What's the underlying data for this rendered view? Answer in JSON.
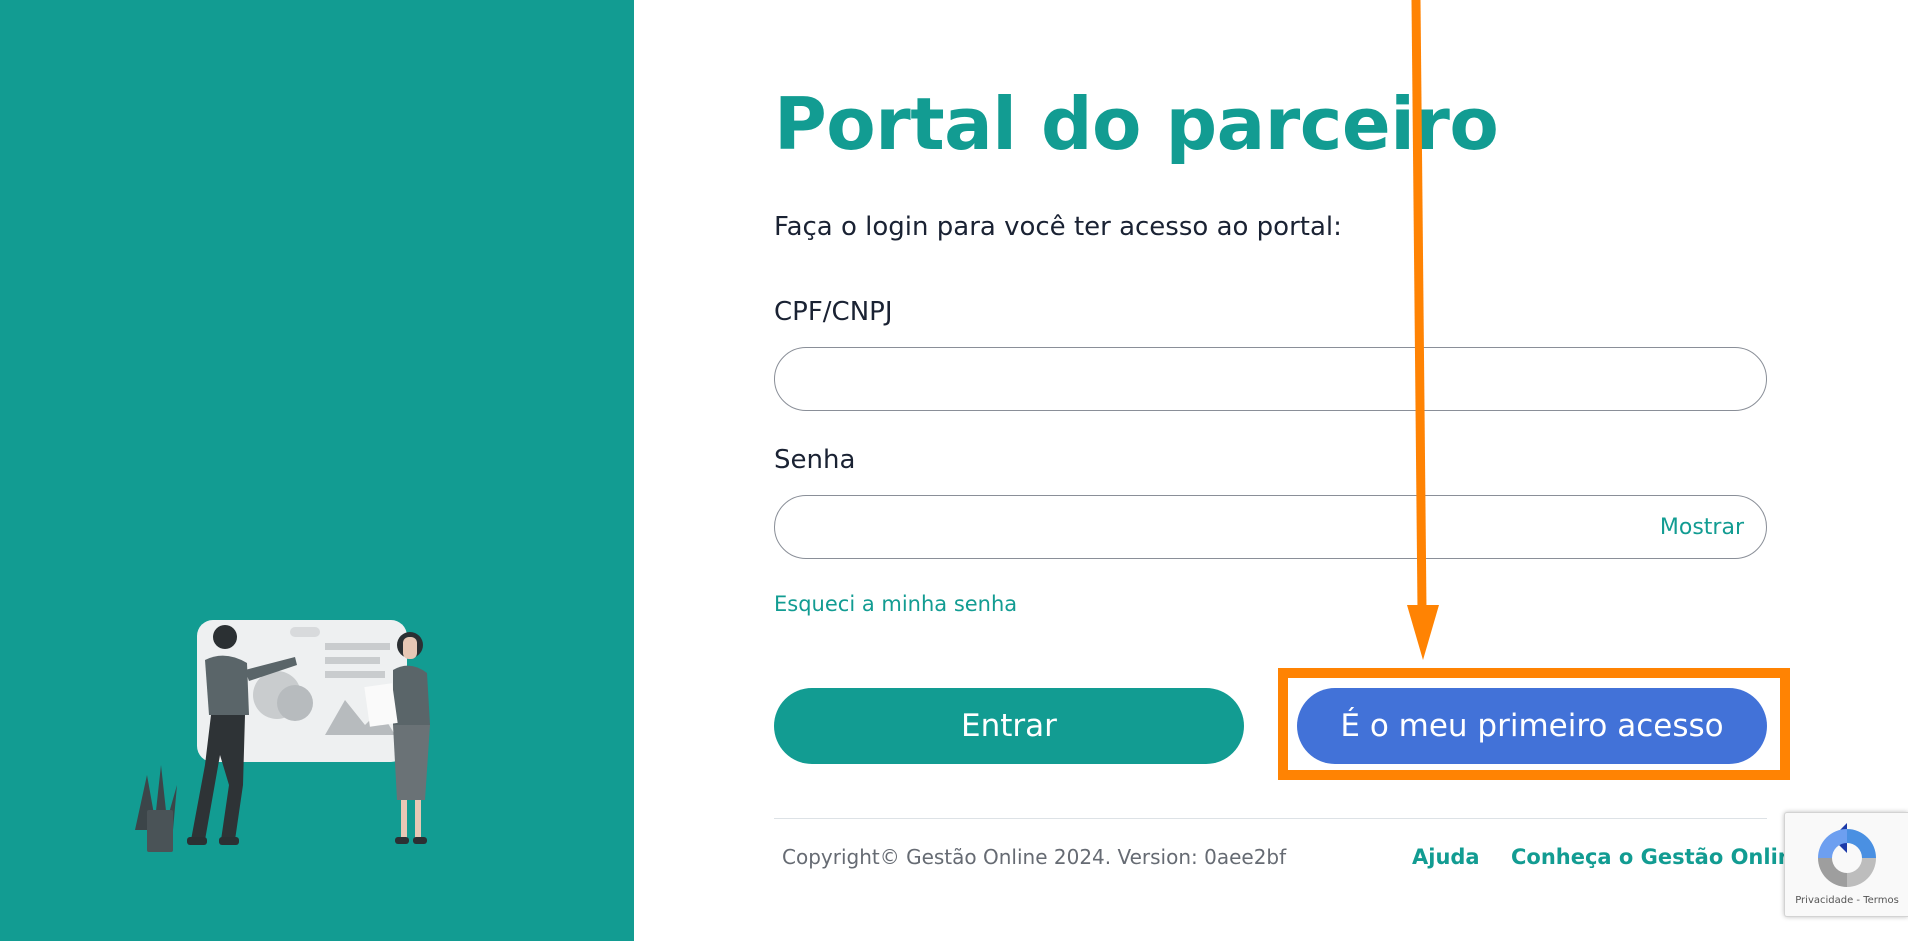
{
  "login": {
    "title": "Portal do parceiro",
    "subtitle": "Faça o login para você ter acesso ao portal:",
    "cpf_label": "CPF/CNPJ",
    "cpf_value": "",
    "password_label": "Senha",
    "password_value": "",
    "show_password": "Mostrar",
    "forgot_password": "Esqueci a minha senha",
    "enter_button": "Entrar",
    "first_access_button": "É o meu primeiro acesso"
  },
  "footer": {
    "copyright": "Copyright© Gestão Online 2024. Version: 0aee2bf",
    "help_link": "Ajuda",
    "about_link": "Conheça o Gestão Online"
  },
  "recaptcha": {
    "text": "Privacidade - Termos",
    "icon": "recaptcha-icon"
  },
  "annotation": {
    "color": "#ff8303",
    "icon": "arrow-down-icon"
  },
  "colors": {
    "brand": "#129c92",
    "primary_button": "#129c92",
    "secondary_button": "#4272d8"
  }
}
